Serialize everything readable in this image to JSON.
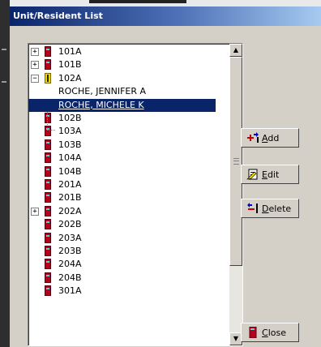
{
  "window": {
    "title": "Unit/Resident List"
  },
  "list": {
    "rows": [
      {
        "label": "101A",
        "expander": "+",
        "icon": "door-closed-icon",
        "type": "unit"
      },
      {
        "label": "101B",
        "expander": "+",
        "icon": "door-closed-icon",
        "type": "unit"
      },
      {
        "label": "102A",
        "expander": "−",
        "icon": "door-open-icon",
        "type": "unit"
      },
      {
        "label": "ROCHE, JENNIFER A",
        "expander": "",
        "icon": "",
        "type": "resident"
      },
      {
        "label": "ROCHE, MICHELE K",
        "expander": "",
        "icon": "",
        "type": "resident",
        "selected": true
      },
      {
        "label": "102B",
        "expander": "",
        "icon": "door-closed-icon",
        "type": "unit"
      },
      {
        "label": "103A",
        "expander": "",
        "icon": "door-closed-icon",
        "type": "unit"
      },
      {
        "label": "103B",
        "expander": "",
        "icon": "door-closed-icon",
        "type": "unit"
      },
      {
        "label": "104A",
        "expander": "",
        "icon": "door-closed-icon",
        "type": "unit"
      },
      {
        "label": "104B",
        "expander": "",
        "icon": "door-closed-icon",
        "type": "unit"
      },
      {
        "label": "201A",
        "expander": "",
        "icon": "door-closed-icon",
        "type": "unit"
      },
      {
        "label": "201B",
        "expander": "",
        "icon": "door-closed-icon",
        "type": "unit"
      },
      {
        "label": "202A",
        "expander": "+",
        "icon": "door-closed-icon",
        "type": "unit"
      },
      {
        "label": "202B",
        "expander": "",
        "icon": "door-closed-icon",
        "type": "unit"
      },
      {
        "label": "203A",
        "expander": "",
        "icon": "door-closed-icon",
        "type": "unit"
      },
      {
        "label": "203B",
        "expander": "",
        "icon": "door-closed-icon",
        "type": "unit"
      },
      {
        "label": "204A",
        "expander": "",
        "icon": "door-closed-icon",
        "type": "unit"
      },
      {
        "label": "204B",
        "expander": "",
        "icon": "door-closed-icon",
        "type": "unit"
      },
      {
        "label": "301A",
        "expander": "",
        "icon": "door-closed-icon",
        "type": "unit"
      }
    ]
  },
  "buttons": {
    "add": {
      "mnemonic": "A",
      "rest": "dd"
    },
    "edit": {
      "mnemonic": "E",
      "rest": "dit"
    },
    "delete": {
      "mnemonic": "D",
      "rest": "elete"
    },
    "close": {
      "mnemonic": "C",
      "rest": "lose"
    }
  },
  "colors": {
    "selection": "#0a246a",
    "door": "#b3001b",
    "door_open": "#f2d600"
  }
}
